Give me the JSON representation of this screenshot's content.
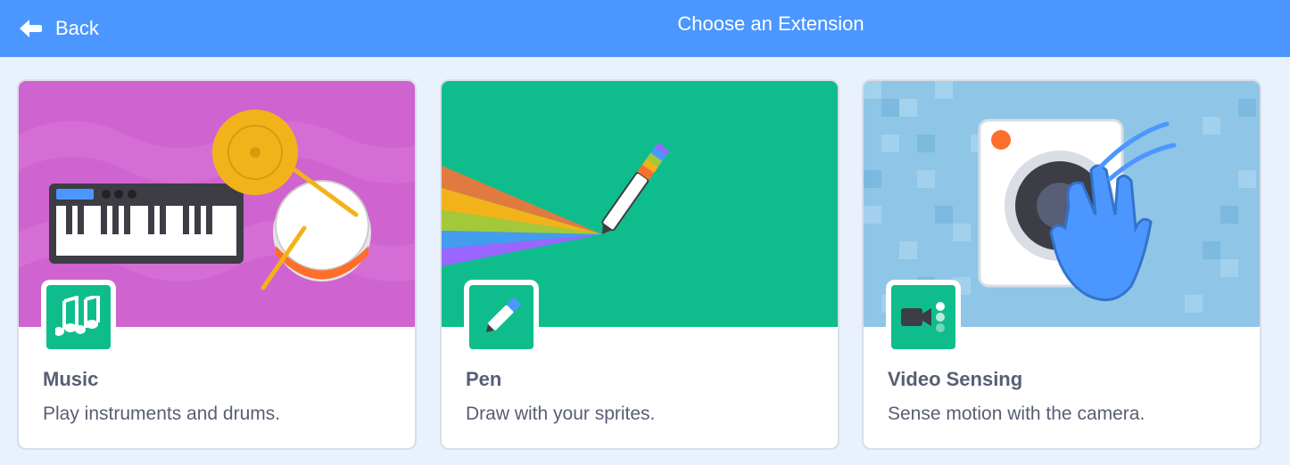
{
  "header": {
    "back_label": "Back",
    "title": "Choose an Extension"
  },
  "extensions": [
    {
      "name": "Music",
      "description": "Play instruments and drums.",
      "banner_color": "#cf63cf",
      "icon": "music-notes-icon"
    },
    {
      "name": "Pen",
      "description": "Draw with your sprites.",
      "banner_color": "#0fbd8c",
      "icon": "pen-icon"
    },
    {
      "name": "Video Sensing",
      "description": "Sense motion with the camera.",
      "banner_color": "#8fc5e6",
      "icon": "video-camera-icon"
    }
  ],
  "colors": {
    "header": "#4c97ff",
    "background": "#e9f1fc",
    "extension_green": "#0fbd8c",
    "text": "#575e75"
  }
}
